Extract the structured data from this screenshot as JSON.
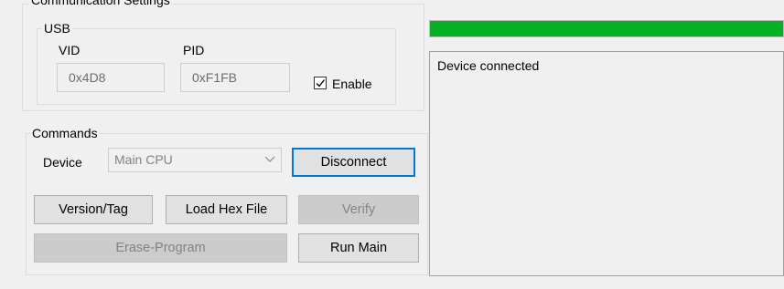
{
  "comm": {
    "title": "Communication Settings",
    "usb": {
      "legend": "USB",
      "vid_label": "VID",
      "vid_value": "0x4D8",
      "pid_label": "PID",
      "pid_value": "0xF1FB",
      "enable_label": "Enable",
      "enable_checked": true
    }
  },
  "commands": {
    "legend": "Commands",
    "device_label": "Device",
    "device_selected": "Main CPU",
    "buttons": {
      "disconnect": "Disconnect",
      "version_tag": "Version/Tag",
      "load_hex": "Load Hex File",
      "verify": "Verify",
      "erase_program": "Erase-Program",
      "run_main": "Run Main"
    }
  },
  "progress": {
    "value": 1.0,
    "color": "#06b025"
  },
  "log": {
    "text": "Device connected"
  },
  "colors": {
    "accent": "#0078d7",
    "progress_green": "#06b025"
  },
  "icons": {
    "checkbox": "check-icon",
    "dropdown": "chevron-down-icon"
  }
}
